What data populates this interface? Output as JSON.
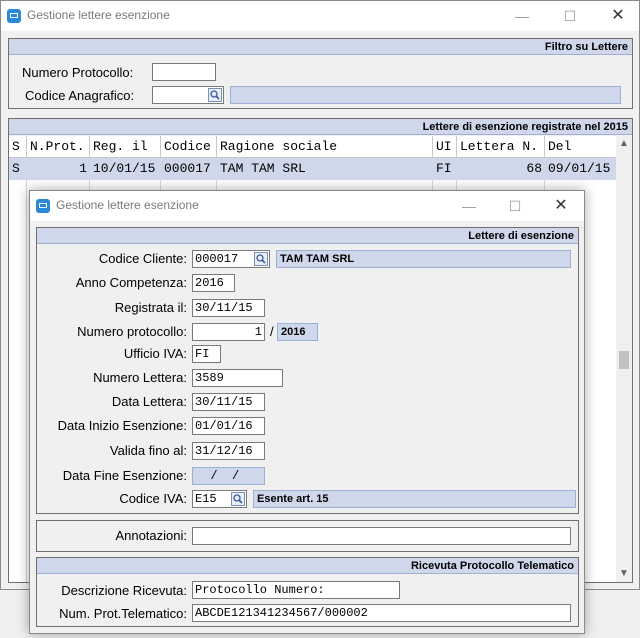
{
  "main_window": {
    "title": "Gestione lettere esenzione",
    "filter_panel": {
      "header": "Filtro su Lettere",
      "numero_protocollo_label": "Numero Protocollo:",
      "numero_protocollo_value": "",
      "codice_anagrafico_label": "Codice Anagrafico:",
      "codice_anagrafico_value": "",
      "ragione_sociale_value": ""
    },
    "list_panel": {
      "header": "Lettere di esenzione registrate nel 2015",
      "columns": [
        "S",
        "N.Prot.",
        "Reg. il",
        "Codice",
        "Ragione sociale",
        "UI",
        "Lettera N.",
        "Del"
      ],
      "rows": [
        {
          "s": "S",
          "nprot": "1",
          "reg": "10/01/15",
          "codice": "000017",
          "ragione": "TAM TAM SRL",
          "ui": "FI",
          "lettera": "68",
          "del": "09/01/15"
        }
      ]
    }
  },
  "dialog": {
    "title": "Gestione lettere esenzione",
    "lettere_panel": {
      "header": "Lettere di esenzione",
      "codice_cliente_label": "Codice Cliente:",
      "codice_cliente_value": "000017",
      "cliente_nome": "TAM TAM SRL",
      "anno_competenza_label": "Anno Competenza:",
      "anno_competenza_value": "2016",
      "registrata_il_label": "Registrata il:",
      "registrata_il_value": "30/11/15",
      "numero_protocollo_label": "Numero protocollo:",
      "numero_protocollo_value": "1",
      "protocollo_sep": "/",
      "protocollo_anno": "2016",
      "ufficio_iva_label": "Ufficio IVA:",
      "ufficio_iva_value": "FI",
      "numero_lettera_label": "Numero Lettera:",
      "numero_lettera_value": "3589",
      "data_lettera_label": "Data Lettera:",
      "data_lettera_value": "30/11/15",
      "data_inizio_label": "Data Inizio Esenzione:",
      "data_inizio_value": "01/01/16",
      "valida_fino_label": "Valida fino al:",
      "valida_fino_value": "31/12/16",
      "data_fine_label": "Data Fine Esenzione:",
      "data_fine_value": "  /  /",
      "codice_iva_label": "Codice IVA:",
      "codice_iva_value": "E15",
      "codice_iva_desc": "Esente art. 15"
    },
    "annotazioni_label": "Annotazioni:",
    "annotazioni_value": "",
    "ricevuta_panel": {
      "header": "Ricevuta Protocollo Telematico",
      "descrizione_label": "Descrizione Ricevuta:",
      "descrizione_value": "Protocollo Numero:",
      "num_prot_label": "Num. Prot.Telematico:",
      "num_prot_value": "ABCDE121341234567/000002"
    }
  },
  "icons": {
    "window_buttons": {
      "minimize": "minimize-icon",
      "maximize": "maximize-icon",
      "close": "close-icon"
    },
    "lookup": "search-icon"
  },
  "colors": {
    "panel_header_bg": "#cfd8eb",
    "selected_row_bg": "#cfd8eb",
    "window_bg": "#f0f0f0"
  }
}
